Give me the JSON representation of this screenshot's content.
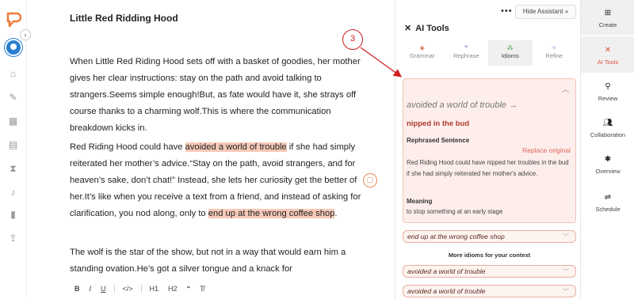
{
  "editor": {
    "title": "Little Red Ridding Hood",
    "para1": "When Little Red Riding Hood sets off with a basket of goodies, her mother gives her clear instructions: stay on the path and avoid talking to strangers.Seems simple enough!But, as fate would have it, she strays off course thanks to a charming wolf.This is where the communication breakdown kicks in.",
    "para2_a": "Red Riding Hood could have ",
    "para2_hl1": "avoided a world of trouble",
    "para2_b": " if she had simply reiterated her mother’s advice.“Stay on the path, avoid strangers, and for heaven’s sake, don’t chat!” Instead, she lets her curiosity get the better of her.It’s like when you receive a text from a friend, and instead of asking for clarification, you nod along, only to ",
    "para2_hl2": "end up at the wrong coffee shop",
    "para2_c": ".",
    "para3": "The wolf is the star of the show, but not in a way that would earn him a standing ovation.He’s got a silver tongue and a knack for",
    "format": {
      "bold": "B",
      "italic": "I",
      "underline": "U",
      "code": "</>",
      "h1": "H1",
      "h2": "H2",
      "quote": "“",
      "clear": "T̸"
    }
  },
  "panel": {
    "hide_label": "Hide Assistant »",
    "dots": "•••",
    "title": "AI Tools",
    "tabs": [
      {
        "label": "Grammar"
      },
      {
        "label": "Rephrase"
      },
      {
        "label": "Idioms"
      },
      {
        "label": "Refine"
      }
    ],
    "card": {
      "original": "avoided a world of trouble →",
      "idiom": "nipped in the bud",
      "rephrased_label": "Rephrased Sentence",
      "replace_label": "Replace original",
      "rephrased": "Red Riding Hood could have nipped her troubles in the bud if she had simply reiterated her mother's advice.",
      "meaning_label": "Meaning",
      "meaning": "to stop something at an early stage"
    },
    "pill1": "end up at the wrong coffee shop",
    "more_label": "More idioms for your context",
    "pill2": "avoided a world of trouble",
    "pill3": "avoided a world of trouble"
  },
  "rnav": {
    "items": [
      {
        "label": "Create"
      },
      {
        "label": "AI Tools"
      },
      {
        "label": "Review"
      },
      {
        "label": "Collaboration"
      },
      {
        "label": "Overview"
      },
      {
        "label": "Schedule"
      }
    ]
  },
  "annotation": {
    "number": "3"
  },
  "colors": {
    "accent": "#e05040",
    "highlight": "#f6c9b8",
    "card_bg": "#fdeeeb"
  }
}
